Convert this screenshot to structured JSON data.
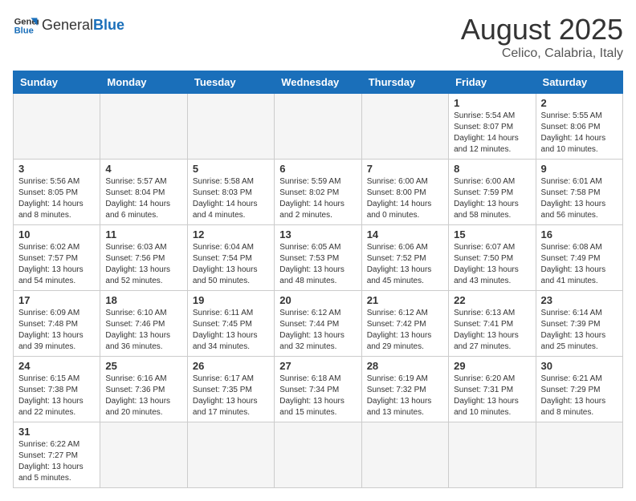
{
  "header": {
    "logo_general": "General",
    "logo_blue": "Blue",
    "title": "August 2025",
    "subtitle": "Celico, Calabria, Italy"
  },
  "weekdays": [
    "Sunday",
    "Monday",
    "Tuesday",
    "Wednesday",
    "Thursday",
    "Friday",
    "Saturday"
  ],
  "weeks": [
    [
      {
        "day": "",
        "info": ""
      },
      {
        "day": "",
        "info": ""
      },
      {
        "day": "",
        "info": ""
      },
      {
        "day": "",
        "info": ""
      },
      {
        "day": "",
        "info": ""
      },
      {
        "day": "1",
        "info": "Sunrise: 5:54 AM\nSunset: 8:07 PM\nDaylight: 14 hours\nand 12 minutes."
      },
      {
        "day": "2",
        "info": "Sunrise: 5:55 AM\nSunset: 8:06 PM\nDaylight: 14 hours\nand 10 minutes."
      }
    ],
    [
      {
        "day": "3",
        "info": "Sunrise: 5:56 AM\nSunset: 8:05 PM\nDaylight: 14 hours\nand 8 minutes."
      },
      {
        "day": "4",
        "info": "Sunrise: 5:57 AM\nSunset: 8:04 PM\nDaylight: 14 hours\nand 6 minutes."
      },
      {
        "day": "5",
        "info": "Sunrise: 5:58 AM\nSunset: 8:03 PM\nDaylight: 14 hours\nand 4 minutes."
      },
      {
        "day": "6",
        "info": "Sunrise: 5:59 AM\nSunset: 8:02 PM\nDaylight: 14 hours\nand 2 minutes."
      },
      {
        "day": "7",
        "info": "Sunrise: 6:00 AM\nSunset: 8:00 PM\nDaylight: 14 hours\nand 0 minutes."
      },
      {
        "day": "8",
        "info": "Sunrise: 6:00 AM\nSunset: 7:59 PM\nDaylight: 13 hours\nand 58 minutes."
      },
      {
        "day": "9",
        "info": "Sunrise: 6:01 AM\nSunset: 7:58 PM\nDaylight: 13 hours\nand 56 minutes."
      }
    ],
    [
      {
        "day": "10",
        "info": "Sunrise: 6:02 AM\nSunset: 7:57 PM\nDaylight: 13 hours\nand 54 minutes."
      },
      {
        "day": "11",
        "info": "Sunrise: 6:03 AM\nSunset: 7:56 PM\nDaylight: 13 hours\nand 52 minutes."
      },
      {
        "day": "12",
        "info": "Sunrise: 6:04 AM\nSunset: 7:54 PM\nDaylight: 13 hours\nand 50 minutes."
      },
      {
        "day": "13",
        "info": "Sunrise: 6:05 AM\nSunset: 7:53 PM\nDaylight: 13 hours\nand 48 minutes."
      },
      {
        "day": "14",
        "info": "Sunrise: 6:06 AM\nSunset: 7:52 PM\nDaylight: 13 hours\nand 45 minutes."
      },
      {
        "day": "15",
        "info": "Sunrise: 6:07 AM\nSunset: 7:50 PM\nDaylight: 13 hours\nand 43 minutes."
      },
      {
        "day": "16",
        "info": "Sunrise: 6:08 AM\nSunset: 7:49 PM\nDaylight: 13 hours\nand 41 minutes."
      }
    ],
    [
      {
        "day": "17",
        "info": "Sunrise: 6:09 AM\nSunset: 7:48 PM\nDaylight: 13 hours\nand 39 minutes."
      },
      {
        "day": "18",
        "info": "Sunrise: 6:10 AM\nSunset: 7:46 PM\nDaylight: 13 hours\nand 36 minutes."
      },
      {
        "day": "19",
        "info": "Sunrise: 6:11 AM\nSunset: 7:45 PM\nDaylight: 13 hours\nand 34 minutes."
      },
      {
        "day": "20",
        "info": "Sunrise: 6:12 AM\nSunset: 7:44 PM\nDaylight: 13 hours\nand 32 minutes."
      },
      {
        "day": "21",
        "info": "Sunrise: 6:12 AM\nSunset: 7:42 PM\nDaylight: 13 hours\nand 29 minutes."
      },
      {
        "day": "22",
        "info": "Sunrise: 6:13 AM\nSunset: 7:41 PM\nDaylight: 13 hours\nand 27 minutes."
      },
      {
        "day": "23",
        "info": "Sunrise: 6:14 AM\nSunset: 7:39 PM\nDaylight: 13 hours\nand 25 minutes."
      }
    ],
    [
      {
        "day": "24",
        "info": "Sunrise: 6:15 AM\nSunset: 7:38 PM\nDaylight: 13 hours\nand 22 minutes."
      },
      {
        "day": "25",
        "info": "Sunrise: 6:16 AM\nSunset: 7:36 PM\nDaylight: 13 hours\nand 20 minutes."
      },
      {
        "day": "26",
        "info": "Sunrise: 6:17 AM\nSunset: 7:35 PM\nDaylight: 13 hours\nand 17 minutes."
      },
      {
        "day": "27",
        "info": "Sunrise: 6:18 AM\nSunset: 7:34 PM\nDaylight: 13 hours\nand 15 minutes."
      },
      {
        "day": "28",
        "info": "Sunrise: 6:19 AM\nSunset: 7:32 PM\nDaylight: 13 hours\nand 13 minutes."
      },
      {
        "day": "29",
        "info": "Sunrise: 6:20 AM\nSunset: 7:31 PM\nDaylight: 13 hours\nand 10 minutes."
      },
      {
        "day": "30",
        "info": "Sunrise: 6:21 AM\nSunset: 7:29 PM\nDaylight: 13 hours\nand 8 minutes."
      }
    ],
    [
      {
        "day": "31",
        "info": "Sunrise: 6:22 AM\nSunset: 7:27 PM\nDaylight: 13 hours\nand 5 minutes."
      },
      {
        "day": "",
        "info": ""
      },
      {
        "day": "",
        "info": ""
      },
      {
        "day": "",
        "info": ""
      },
      {
        "day": "",
        "info": ""
      },
      {
        "day": "",
        "info": ""
      },
      {
        "day": "",
        "info": ""
      }
    ]
  ]
}
